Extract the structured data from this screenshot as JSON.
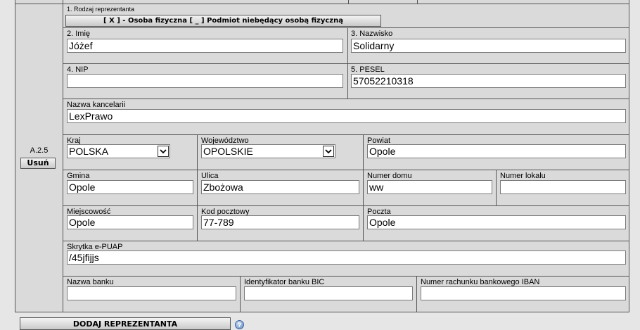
{
  "representative_type": {
    "label": "1. Rodzaj reprezentanta",
    "toggle_text": "[ X ] - Osoba fizyczna [ _ ] Podmiot niebędący osobą fizyczną"
  },
  "section": {
    "code": "A.2.5",
    "remove_label": "Usuń"
  },
  "fields": {
    "imie": {
      "label": "2. Imię",
      "value": "Jóżef"
    },
    "nazwisko": {
      "label": "3. Nazwisko",
      "value": "Solidarny"
    },
    "nip": {
      "label": "4. NIP",
      "value": ""
    },
    "pesel": {
      "label": "5. PESEL",
      "value": "57052210318"
    },
    "kancelaria": {
      "label": "Nazwa kancelarii",
      "value": "LexPrawo"
    },
    "kraj": {
      "label": "Kraj",
      "value": "POLSKA"
    },
    "wojewodztwo": {
      "label": "Województwo",
      "value": "OPOLSKIE"
    },
    "powiat": {
      "label": "Powiat",
      "value": "Opole"
    },
    "gmina": {
      "label": "Gmina",
      "value": "Opole"
    },
    "ulica": {
      "label": "Ulica",
      "value": "Zbożowa"
    },
    "numer_domu": {
      "label": "Numer domu",
      "value": "ww"
    },
    "numer_lokalu": {
      "label": "Numer lokalu",
      "value": ""
    },
    "miejscowosc": {
      "label": "Miejscowość",
      "value": "Opole"
    },
    "kod_pocztowy": {
      "label": "Kod pocztowy",
      "value": "77-789"
    },
    "poczta": {
      "label": "Poczta",
      "value": "Opole"
    },
    "skrytka": {
      "label": "Skrytka e-PUAP",
      "value": "/45jfijjs"
    },
    "nazwa_banku": {
      "label": "Nazwa banku",
      "value": ""
    },
    "bic": {
      "label": "Identyfikator banku BIC",
      "value": ""
    },
    "iban": {
      "label": "Numer rachunku bankowego IBAN",
      "value": ""
    }
  },
  "footer": {
    "add_label": "DODAJ REPREZENTANTA",
    "help_icon": "help-icon"
  },
  "colors": {
    "panel": "#dadada",
    "border": "#555555",
    "page": "#e6e6e6"
  }
}
